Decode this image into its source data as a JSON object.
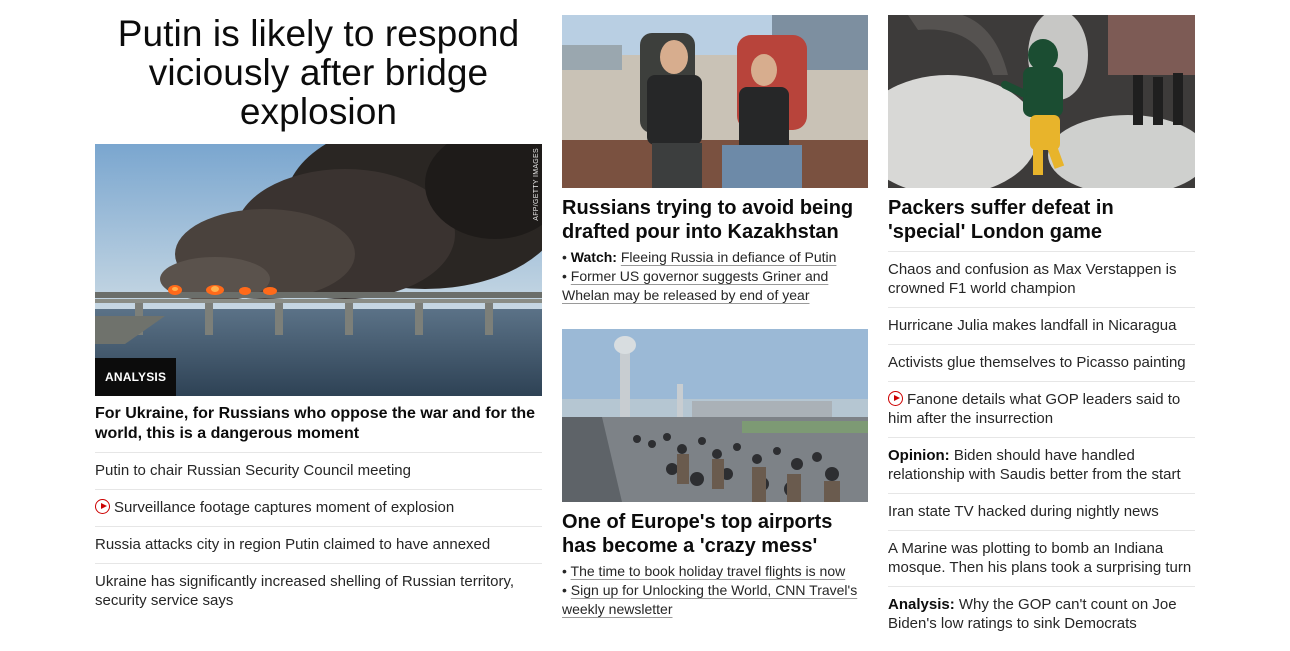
{
  "col1": {
    "headline": "Putin is likely to respond viciously after bridge explosion",
    "image_badge": "ANALYSIS",
    "image_credit": "AFP/GETTY IMAGES",
    "sub_headline": "For Ukraine, for Russians who oppose the war and for the world, this is a dangerous moment",
    "list": [
      {
        "text": "Putin to chair Russian Security Council meeting",
        "video": false
      },
      {
        "text": "Surveillance footage captures moment of explosion",
        "video": true
      },
      {
        "text": "Russia attacks city in region Putin claimed to have annexed",
        "video": false
      },
      {
        "text": "Ukraine has significantly increased shelling of Russian territory, security service says",
        "video": false
      }
    ]
  },
  "col2": {
    "story1": {
      "title": "Russians trying to avoid being drafted pour into Kazakhstan",
      "bullet1_prefix": "Watch:",
      "bullet1_text": "Fleeing Russia in defiance of Putin",
      "bullet2_text": "Former US governor suggests Griner and Whelan may be released by end of year"
    },
    "story2": {
      "title": "One of Europe's top airports has become a 'crazy mess'",
      "bullet1_text": "The time to book holiday travel flights is now",
      "bullet2_text": "Sign up for Unlocking the World, CNN Travel's weekly newsletter"
    }
  },
  "col3": {
    "title": "Packers suffer defeat in 'special' London game",
    "list": [
      {
        "prefix": "",
        "text": "Chaos and confusion as Max Verstappen is crowned F1 world champion",
        "video": false
      },
      {
        "prefix": "",
        "text": "Hurricane Julia makes landfall in Nicaragua",
        "video": false
      },
      {
        "prefix": "",
        "text": "Activists glue themselves to Picasso painting",
        "video": false
      },
      {
        "prefix": "",
        "text": "Fanone details what GOP leaders said to him after the insurrection",
        "video": true
      },
      {
        "prefix": "Opinion:",
        "text": "Biden should have handled relationship with Saudis better from the start",
        "video": false
      },
      {
        "prefix": "",
        "text": "Iran state TV hacked during nightly news",
        "video": false
      },
      {
        "prefix": "",
        "text": "A Marine was plotting to bomb an Indiana mosque. Then his plans took a surprising turn",
        "video": false
      },
      {
        "prefix": "Analysis:",
        "text": "Why the GOP can't count on Joe Biden's low ratings to sink Democrats",
        "video": false
      }
    ]
  },
  "colors": {
    "text": "#0c0c0c",
    "secondary_text": "#262626",
    "divider": "#e6e6e6",
    "video_accent": "#cc0000",
    "badge_bg": "#0c0c0c"
  },
  "icons": {
    "video": "play-circle-icon"
  }
}
